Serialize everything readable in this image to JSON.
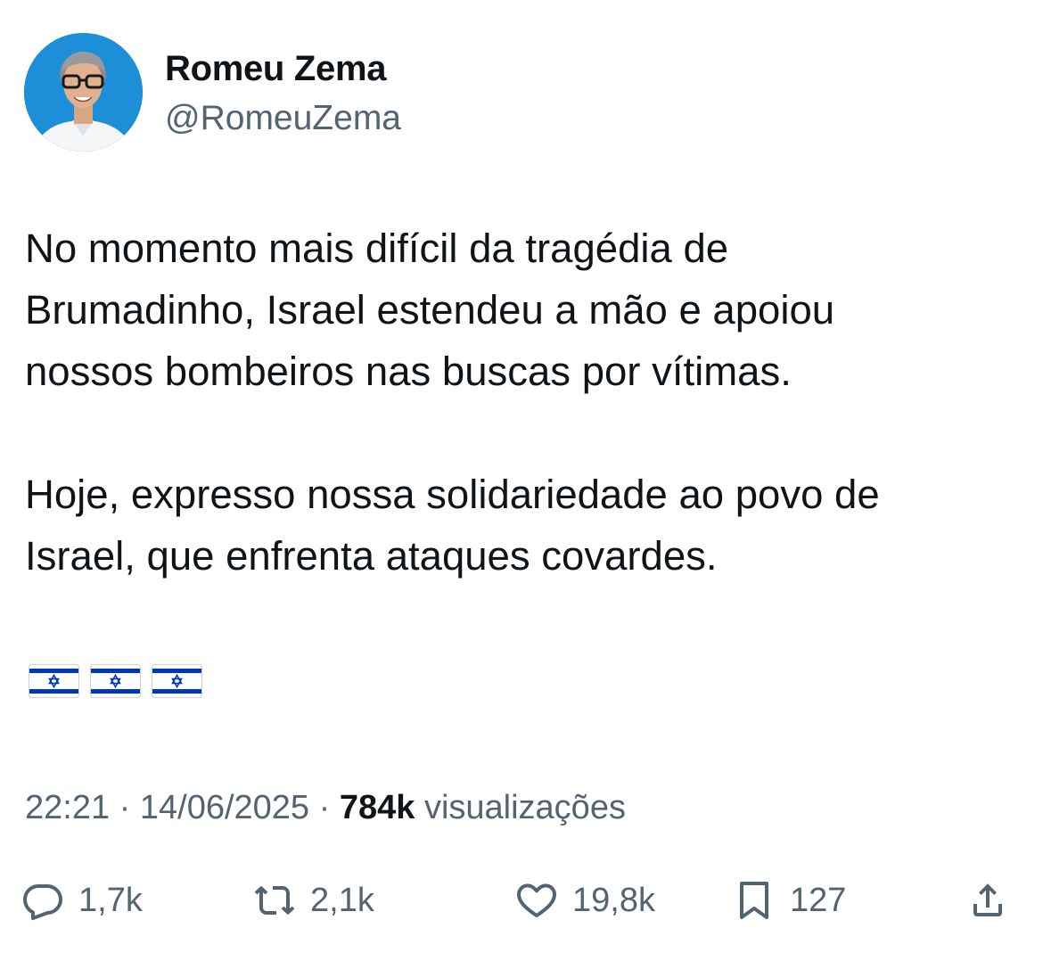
{
  "author": {
    "name": "Romeu Zema",
    "handle": "@RomeuZema",
    "avatar_icon": "avatar-photo"
  },
  "tweet": {
    "paragraphs": [
      "No momento mais difícil da tragédia de\nBrumadinho, Israel estendeu a mão e apoiou\nnossos bombeiros nas buscas por vítimas.",
      "Hoje, expresso nossa solidariedade ao povo de\nIsrael, que enfrenta ataques covardes."
    ],
    "emoji": [
      "israel-flag",
      "israel-flag",
      "israel-flag"
    ]
  },
  "meta": {
    "time": "22:21",
    "separator": "·",
    "date": "14/06/2025",
    "views_count": "784k",
    "views_label": "visualizações"
  },
  "actions": {
    "reply": {
      "icon": "reply-icon",
      "count": "1,7k"
    },
    "retweet": {
      "icon": "retweet-icon",
      "count": "2,1k"
    },
    "like": {
      "icon": "heart-icon",
      "count": "19,8k"
    },
    "bookmark": {
      "icon": "bookmark-icon",
      "count": "127"
    },
    "share": {
      "icon": "share-icon"
    }
  },
  "colors": {
    "text_primary": "#0f1419",
    "text_secondary": "#536471",
    "avatar_background": "#1d8fd9",
    "flag_blue": "#0038b8"
  }
}
